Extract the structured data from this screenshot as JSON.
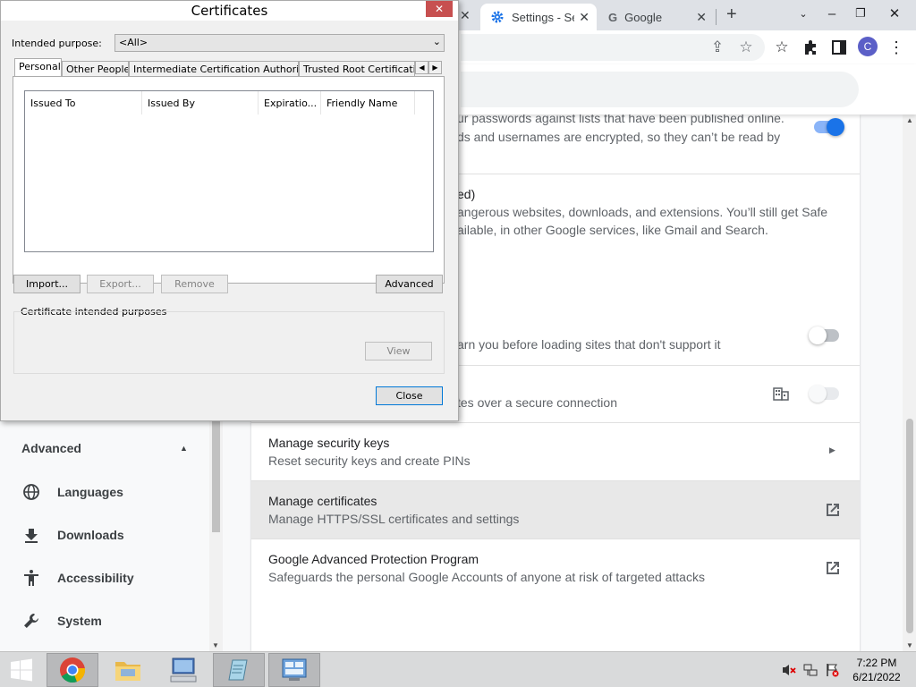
{
  "browser": {
    "tabs": [
      {
        "title": "Settings - Se",
        "active": true
      },
      {
        "title": "Google",
        "active": false
      }
    ],
    "colors": {
      "accent": "#1a73e8",
      "toggle_on_track": "#8ab4f8",
      "highlight_row": "#e8e8e8"
    }
  },
  "settings": {
    "fragments": {
      "passwords_line1": "ur passwords against lists that have been published online.",
      "passwords_line2": "ds and usernames are encrypted, so they can’t be read by",
      "safe_heading": "ed)",
      "safe_line1": "angerous websites, downloads, and extensions. You’ll still get Safe",
      "safe_line2": "ailable, in other Google services, like Gmail and Search.",
      "https_line": "arn you before loading sites that don't support it",
      "dns_line": "tes over a secure connection"
    },
    "rows": [
      {
        "title": "Manage security keys",
        "subtitle": "Reset security keys and create PINs"
      },
      {
        "title": "Manage certificates",
        "subtitle": "Manage HTTPS/SSL certificates and settings"
      },
      {
        "title": "Google Advanced Protection Program",
        "subtitle": "Safeguards the personal Google Accounts of anyone at risk of targeted attacks"
      }
    ],
    "toggles": {
      "password_check": true,
      "https_only": false,
      "secure_dns": false
    }
  },
  "sidebar": {
    "advanced_label": "Advanced",
    "items": [
      {
        "label": "Languages",
        "icon": "globe-icon"
      },
      {
        "label": "Downloads",
        "icon": "download-icon"
      },
      {
        "label": "Accessibility",
        "icon": "accessibility-icon"
      },
      {
        "label": "System",
        "icon": "wrench-icon"
      }
    ]
  },
  "dialog": {
    "title": "Certificates",
    "intended_purpose_label": "Intended purpose:",
    "intended_purpose_value": "<All>",
    "tabs": [
      "Personal",
      "Other People",
      "Intermediate Certification Authorities",
      "Trusted Root Certification"
    ],
    "columns": [
      "Issued To",
      "Issued By",
      "Expiratio...",
      "Friendly Name"
    ],
    "buttons": {
      "import": "Import...",
      "export": "Export...",
      "remove": "Remove",
      "advanced": "Advanced",
      "view": "View",
      "close": "Close"
    },
    "purposes_label": "Certificate intended purposes"
  },
  "taskbar": {
    "time": "7:22 PM",
    "date": "6/21/2022"
  }
}
